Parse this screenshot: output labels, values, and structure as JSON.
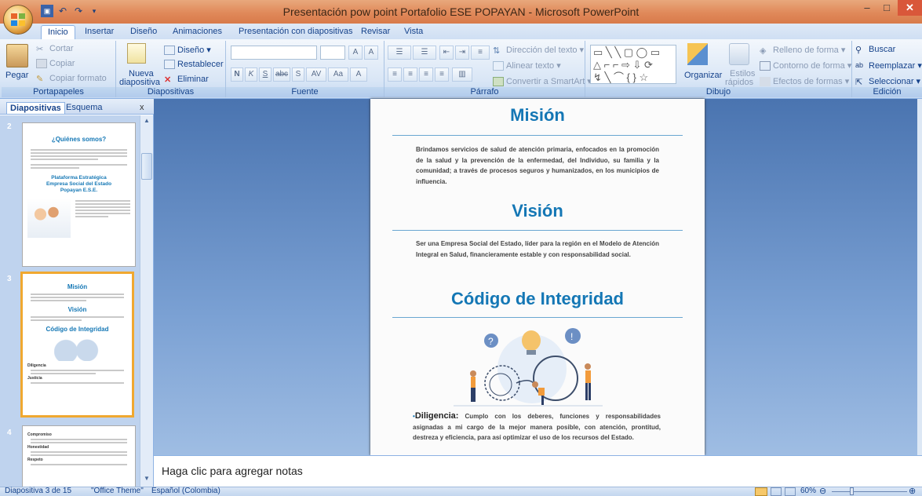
{
  "window": {
    "title": "Presentación pow point Portafolio ESE POPAYAN - Microsoft PowerPoint",
    "controls": {
      "minimize": "–",
      "maximize": "□",
      "close": "✕"
    }
  },
  "tabs": [
    "Inicio",
    "Insertar",
    "Diseño",
    "Animaciones",
    "Presentación con diapositivas",
    "Revisar",
    "Vista"
  ],
  "ribbon": {
    "portapapeles": {
      "label": "Portapapeles",
      "paste": "Pegar",
      "cut": "Cortar",
      "copy": "Copiar",
      "format_painter": "Copiar formato"
    },
    "diapositivas": {
      "label": "Diapositivas",
      "new_slide_1": "Nueva",
      "new_slide_2": "diapositiva",
      "layout": "Diseño",
      "reset": "Restablecer",
      "delete": "Eliminar"
    },
    "fuente": {
      "label": "Fuente",
      "bold": "N",
      "italic": "K",
      "underline": "S",
      "strike": "abc",
      "shadow": "S",
      "spacing": "AV",
      "case": "Aa",
      "color": "A",
      "grow": "A",
      "shrink": "A"
    },
    "parrafo": {
      "label": "Párrafo",
      "text_direction": "Dirección del texto",
      "align_text": "Alinear texto",
      "smartart": "Convertir a SmartArt"
    },
    "dibujo": {
      "label": "Dibujo",
      "arrange": "Organizar",
      "quick_styles_1": "Estilos",
      "quick_styles_2": "rápidos",
      "fill": "Relleno de forma",
      "outline": "Contorno de forma",
      "effects": "Efectos de formas"
    },
    "edicion": {
      "label": "Edición",
      "find": "Buscar",
      "replace": "Reemplazar",
      "select": "Seleccionar"
    }
  },
  "pane": {
    "tab_slides": "Diapositivas",
    "tab_outline": "Esquema",
    "close": "x",
    "thumbs": [
      {
        "num": "2",
        "title": "¿Quiénes somos?",
        "subtitle": "Plataforma Estratégica Empresa Social del Estado Popayan E.S.E."
      },
      {
        "num": "3",
        "title1": "Misión",
        "title2": "Visión",
        "title3": "Código de Integridad",
        "item1": "Diligencia",
        "item2": "Justicia"
      },
      {
        "num": "4",
        "item1": "Compromiso",
        "item2": "Honestidad",
        "item3": "Respeto"
      }
    ]
  },
  "slide": {
    "mision_title": "Misión",
    "mision_text": "Brindamos servicios de salud de atención primaria, enfocados en la promoción de la salud y la prevención de la enfermedad, del Individuo, su familia y la comunidad; a través de procesos seguros y humanizados, en los municipios de influencia.",
    "vision_title": "Visión",
    "vision_text": "Ser una Empresa Social del Estado, líder para la región en el Modelo de Atención Integral en Salud, financieramente estable y con responsabilidad social.",
    "codigo_title": "Código de Integridad",
    "diligencia_label": "Diligencia:",
    "diligencia_text": " Cumplo con los deberes, funciones y responsabilidades asignadas a mi cargo de la mejor manera posible, con atención, prontitud, destreza y eficiencia, para así optimizar el uso de los recursos del Estado."
  },
  "notes": {
    "placeholder": "Haga clic para agregar notas"
  },
  "status": {
    "slide_info": "Diapositiva 3 de 15",
    "theme": "\"Office Theme\"",
    "language": "Español (Colombia)",
    "zoom": "60%"
  },
  "colors": {
    "title_bar": "#e0895a",
    "ribbon": "#d9e6f6",
    "slide_title": "#1477b5",
    "canvas": "#5a83bf",
    "selection": "#f0a830"
  }
}
